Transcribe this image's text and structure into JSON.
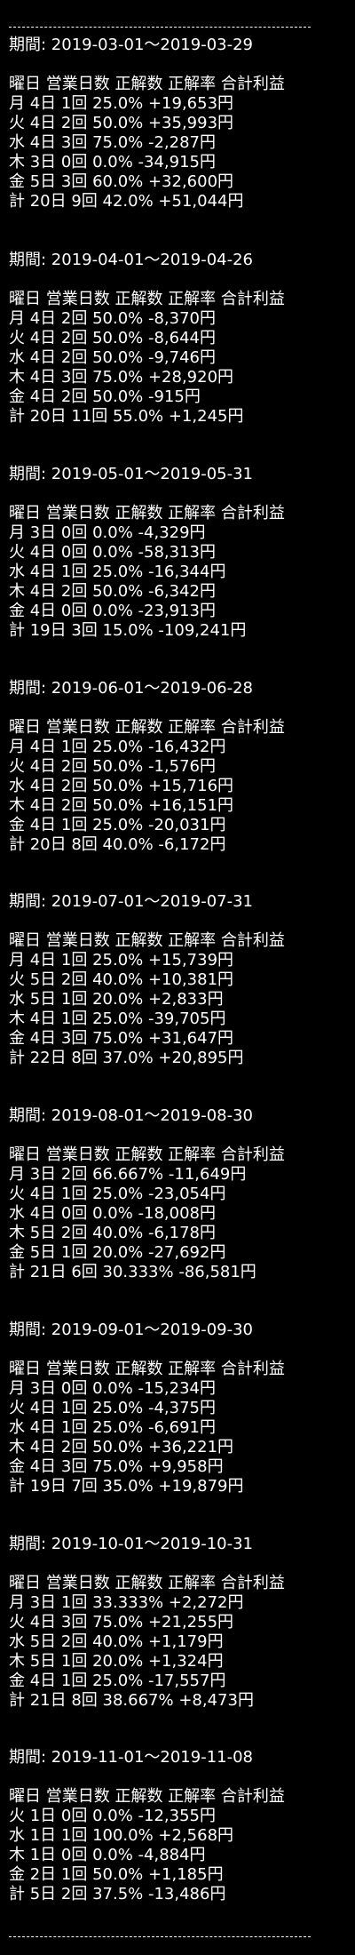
{
  "separator": "------------------------------------------------",
  "header": "曜日 営業日数 正解数 正解率 合計利益",
  "periods": [
    {
      "label": "期間: 2019-03-01～2019-03-29",
      "rows": [
        "月 4日 1回 25.0% +19,653円",
        "火 4日 2回 50.0% +35,993円",
        "水 4日 3回 75.0% -2,287円",
        "木 3日 0回 0.0% -34,915円",
        "金 5日 3回 60.0% +32,600円",
        "計 20日 9回 42.0% +51,044円"
      ]
    },
    {
      "label": "期間: 2019-04-01～2019-04-26",
      "rows": [
        "月 4日 2回 50.0% -8,370円",
        "火 4日 2回 50.0% -8,644円",
        "水 4日 2回 50.0% -9,746円",
        "木 4日 3回 75.0% +28,920円",
        "金 4日 2回 50.0% -915円",
        "計 20日 11回 55.0% +1,245円"
      ]
    },
    {
      "label": "期間: 2019-05-01～2019-05-31",
      "rows": [
        "月 3日 0回 0.0% -4,329円",
        "火 4日 0回 0.0% -58,313円",
        "水 4日 1回 25.0% -16,344円",
        "木 4日 2回 50.0% -6,342円",
        "金 4日 0回 0.0% -23,913円",
        "計 19日 3回 15.0% -109,241円"
      ]
    },
    {
      "label": "期間: 2019-06-01～2019-06-28",
      "rows": [
        "月 4日 1回 25.0% -16,432円",
        "火 4日 2回 50.0% -1,576円",
        "水 4日 2回 50.0% +15,716円",
        "木 4日 2回 50.0% +16,151円",
        "金 4日 1回 25.0% -20,031円",
        "計 20日 8回 40.0% -6,172円"
      ]
    },
    {
      "label": "期間: 2019-07-01～2019-07-31",
      "rows": [
        "月 4日 1回 25.0% +15,739円",
        "火 5日 2回 40.0% +10,381円",
        "水 5日 1回 20.0% +2,833円",
        "木 4日 1回 25.0% -39,705円",
        "金 4日 3回 75.0% +31,647円",
        "計 22日 8回 37.0% +20,895円"
      ]
    },
    {
      "label": "期間: 2019-08-01～2019-08-30",
      "rows": [
        "月 3日 2回 66.667% -11,649円",
        "火 4日 1回 25.0% -23,054円",
        "水 4日 0回 0.0% -18,008円",
        "木 5日 2回 40.0% -6,178円",
        "金 5日 1回 20.0% -27,692円",
        "計 21日 6回 30.333% -86,581円"
      ]
    },
    {
      "label": "期間: 2019-09-01～2019-09-30",
      "rows": [
        "月 3日 0回 0.0% -15,234円",
        "火 4日 1回 25.0% -4,375円",
        "水 4日 1回 25.0% -6,691円",
        "木 4日 2回 50.0% +36,221円",
        "金 4日 3回 75.0% +9,958円",
        "計 19日 7回 35.0% +19,879円"
      ]
    },
    {
      "label": "期間: 2019-10-01～2019-10-31",
      "rows": [
        "月 3日 1回 33.333% +2,272円",
        "火 4日 3回 75.0% +21,255円",
        "水 5日 2回 40.0% +1,179円",
        "木 5日 1回 20.0% +1,324円",
        "金 4日 1回 25.0% -17,557円",
        "計 21日 8回 38.667% +8,473円"
      ]
    },
    {
      "label": "期間: 2019-11-01～2019-11-08",
      "rows": [
        "火 1日 0回 0.0% -12,355円",
        "水 1日 1回 100.0% +2,568円",
        "木 1日 0回 0.0% -4,884円",
        "金 2日 1回 50.0% +1,185円",
        "計 5日 2回 37.5% -13,486円"
      ]
    }
  ]
}
